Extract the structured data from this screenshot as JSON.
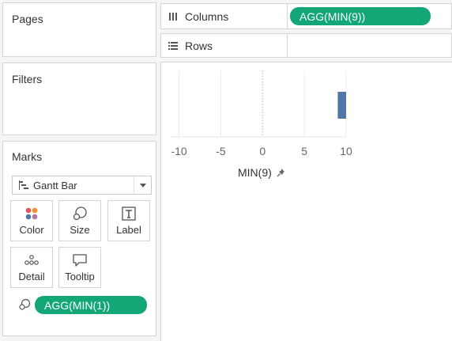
{
  "pages": {
    "title": "Pages"
  },
  "filters": {
    "title": "Filters"
  },
  "columns": {
    "label": "Columns",
    "pill": "AGG(MIN(9))"
  },
  "rows": {
    "label": "Rows"
  },
  "marks": {
    "title": "Marks",
    "mark_type": "Gantt Bar",
    "buttons": [
      {
        "label": "Color",
        "icon": "color-dots-icon"
      },
      {
        "label": "Size",
        "icon": "size-icon"
      },
      {
        "label": "Label",
        "icon": "label-icon"
      },
      {
        "label": "Detail",
        "icon": "detail-icon"
      },
      {
        "label": "Tooltip",
        "icon": "tooltip-icon"
      }
    ],
    "size_pill": "AGG(MIN(1))"
  },
  "view": {
    "axis_title": "MIN(9)",
    "axis_ticks": [
      "-10",
      "-5",
      "0",
      "5",
      "10"
    ]
  },
  "chart_data": {
    "type": "bar",
    "orientation": "horizontal",
    "mark": "Gantt Bar",
    "x": [
      9
    ],
    "size": [
      1
    ],
    "xlabel": "MIN(9)",
    "xlim": [
      -11,
      10
    ],
    "x_ticks": [
      -10,
      -5,
      0,
      5,
      10
    ],
    "bar_color": "#4e79a7",
    "zero_line": "dotted"
  },
  "colors": {
    "pill": "#13a777",
    "bar": "#4e79a7"
  }
}
